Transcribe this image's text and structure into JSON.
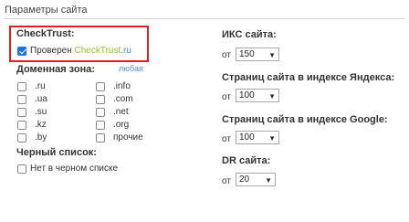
{
  "page": {
    "title": "Параметры сайта"
  },
  "checktrust": {
    "heading": "CheckTrust:",
    "label": "Проверен",
    "brand": "CheckTrust",
    "brand_suffix": ".ru",
    "checked": true
  },
  "domain_zone": {
    "heading": "Доменная зона:",
    "any_label": "любая",
    "left": [
      ".ru",
      ".ua",
      ".su",
      ".kz",
      ".by"
    ],
    "right": [
      ".info",
      ".com",
      ".net",
      ".org",
      "прочие"
    ]
  },
  "blacklist": {
    "heading": "Черный список:",
    "option": "Нет в черном списке"
  },
  "filters": [
    {
      "heading": "ИКС сайта:",
      "prefix": "от",
      "value": "150"
    },
    {
      "heading": "Страниц сайта в индексе Яндекса:",
      "prefix": "от",
      "value": "100"
    },
    {
      "heading": "Страниц сайта в индексе Google:",
      "prefix": "от",
      "value": "100"
    },
    {
      "heading": "DR сайта:",
      "prefix": "от",
      "value": "20"
    }
  ],
  "colors": {
    "highlight_border": "#e02020",
    "checkbox_checked": "#1a73e8",
    "brand_green": "#9bbf2a",
    "brand_blue": "#3a8fd8"
  }
}
